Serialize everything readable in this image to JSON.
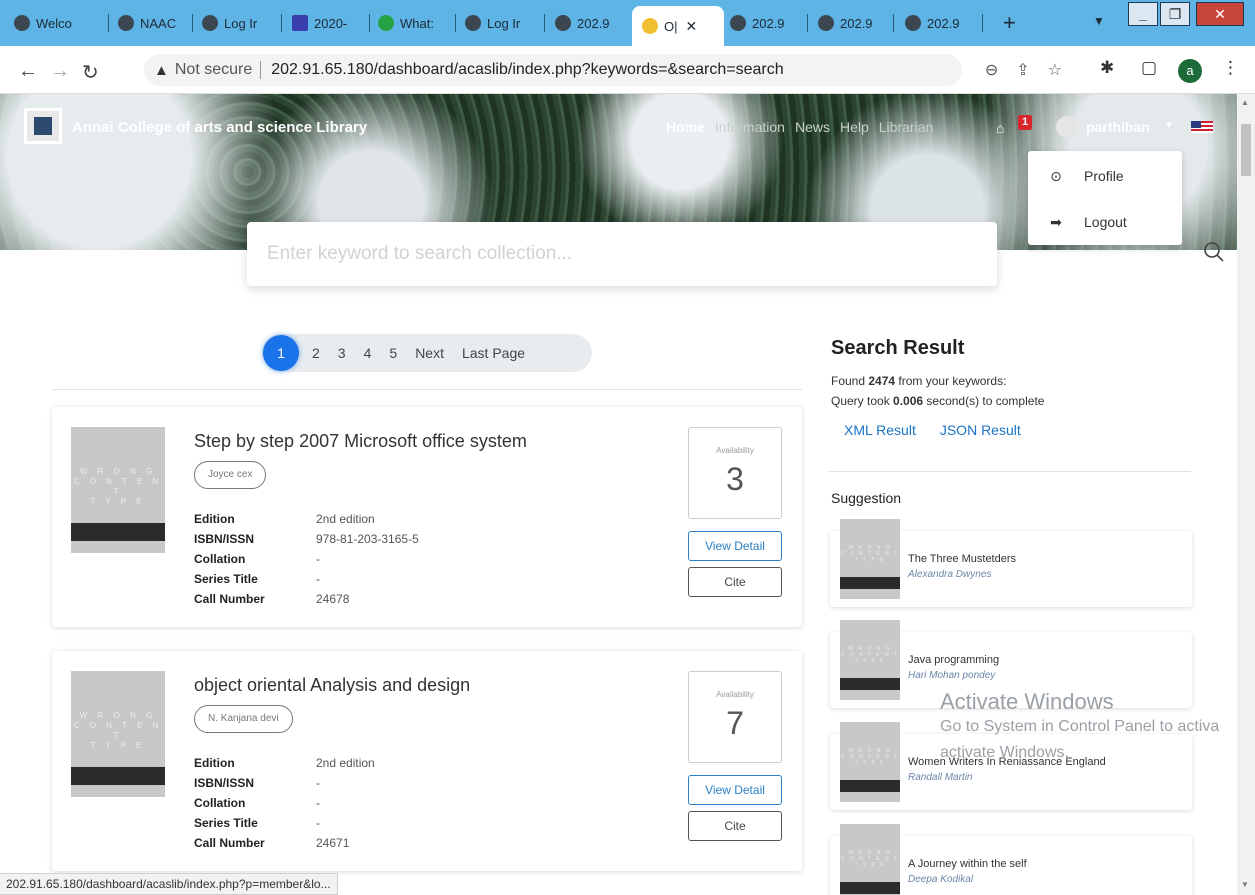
{
  "browser": {
    "tabs": [
      {
        "label": "Welco",
        "active": false
      },
      {
        "label": "NAAC",
        "active": false
      },
      {
        "label": "Log Ir",
        "active": false
      },
      {
        "label": "2020-",
        "active": false
      },
      {
        "label": "What:",
        "active": false
      },
      {
        "label": "Log Ir",
        "active": false
      },
      {
        "label": "202.9",
        "active": false
      },
      {
        "label": "O|",
        "active": true
      },
      {
        "label": "202.9",
        "active": false
      },
      {
        "label": "202.9",
        "active": false
      },
      {
        "label": "202.9",
        "active": false
      }
    ],
    "new_tab": "+",
    "not_secure": "Not secure",
    "url": "202.91.65.180/dashboard/acaslib/index.php?keywords=&search=search",
    "profile_initial": "a",
    "status_url": "202.91.65.180/dashboard/acaslib/index.php?p=member&lo..."
  },
  "site": {
    "brand": "Annai College of arts and science Library",
    "menu": [
      "Home",
      "Information",
      "News",
      "Help",
      "Librarian"
    ],
    "badge": "1",
    "user": "parthiban",
    "dropdown": {
      "profile": "Profile",
      "logout": "Logout"
    }
  },
  "search": {
    "placeholder": "Enter keyword to search collection..."
  },
  "pagination": {
    "current": "1",
    "pages": [
      "2",
      "3",
      "4",
      "5"
    ],
    "next": "Next",
    "last": "Last Page"
  },
  "cover_text": [
    "W R O N G",
    "C O N T E N T",
    "T Y P E"
  ],
  "labels": {
    "edition": "Edition",
    "isbn": "ISBN/ISSN",
    "collation": "Collation",
    "series": "Series Title",
    "call": "Call Number",
    "availability": "Availability",
    "view_detail": "View Detail",
    "cite": "Cite"
  },
  "results": [
    {
      "title": "Step by step 2007 Microsoft office system",
      "author": "Joyce cex",
      "edition": "2nd edition",
      "isbn": "978-81-203-3165-5",
      "collation": "-",
      "series": "-",
      "call": "24678",
      "availability": "3"
    },
    {
      "title": "object oriental Analysis and design",
      "author": "N. Kanjana devi",
      "edition": "2nd edition",
      "isbn": "-",
      "collation": "-",
      "series": "-",
      "call": "24671",
      "availability": "7"
    }
  ],
  "sidebar": {
    "title": "Search Result",
    "found_prefix": "Found ",
    "found_count": "2474",
    "found_suffix": " from your keywords:",
    "query_prefix": "Query took ",
    "query_time": "0.006",
    "query_suffix": " second(s) to complete",
    "xml": "XML Result",
    "json": "JSON Result",
    "suggestion": "Suggestion",
    "suggestions": [
      {
        "title": "The Three Mustetders",
        "author": "Alexandra Dwynes"
      },
      {
        "title": "Java programming",
        "author": "Hari Mohan pondey"
      },
      {
        "title": "Women Writers In Reniassance England",
        "author": "Randall Martin"
      },
      {
        "title": "A Journey within the self",
        "author": "Deepa Kodikal"
      }
    ]
  },
  "watermark": {
    "line1": "Activate Windows",
    "line2": "Go to System in Control Panel to activa",
    "line3": "activate Windows."
  }
}
